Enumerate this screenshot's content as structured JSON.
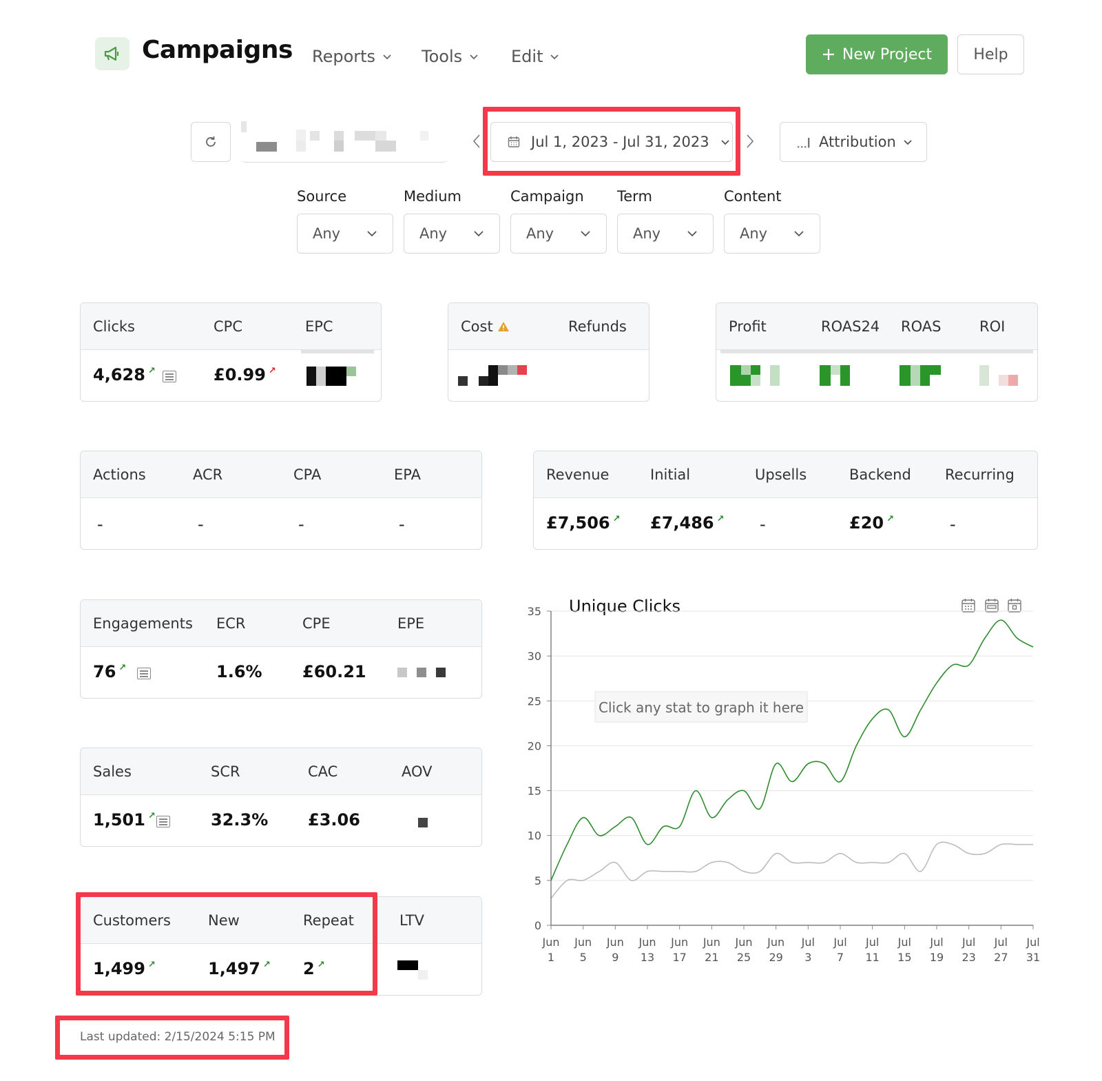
{
  "header": {
    "app_title": "Campaigns",
    "nav": [
      "Reports",
      "Tools",
      "Edit"
    ],
    "new_project_label": "New Project",
    "help_label": "Help"
  },
  "toolbar": {
    "date_range": "Jul 1, 2023 - Jul 31, 2023",
    "attribution_label": "Attribution"
  },
  "filters": [
    {
      "label": "Source",
      "value": "Any"
    },
    {
      "label": "Medium",
      "value": "Any"
    },
    {
      "label": "Campaign",
      "value": "Any"
    },
    {
      "label": "Term",
      "value": "Any"
    },
    {
      "label": "Content",
      "value": "Any"
    }
  ],
  "cards": {
    "traffic": {
      "headers": [
        "Clicks",
        "CPC",
        "EPC"
      ],
      "values": [
        "4,628",
        "£0.99"
      ]
    },
    "cost": {
      "headers": [
        "Cost",
        "Refunds"
      ]
    },
    "profit": {
      "headers": [
        "Profit",
        "ROAS24",
        "ROAS",
        "ROI"
      ]
    },
    "actions": {
      "headers": [
        "Actions",
        "ACR",
        "CPA",
        "EPA"
      ],
      "values": [
        "-",
        "-",
        "-",
        "-"
      ]
    },
    "revenue": {
      "headers": [
        "Revenue",
        "Initial",
        "Upsells",
        "Backend",
        "Recurring"
      ],
      "values": [
        "£7,506",
        "£7,486",
        "-",
        "£20",
        "-"
      ]
    },
    "engagements": {
      "headers": [
        "Engagements",
        "ECR",
        "CPE",
        "EPE"
      ],
      "values": [
        "76",
        "1.6%",
        "£60.21"
      ]
    },
    "sales": {
      "headers": [
        "Sales",
        "SCR",
        "CAC",
        "AOV"
      ],
      "values": [
        "1,501",
        "32.3%",
        "£3.06"
      ]
    },
    "customers": {
      "headers": [
        "Customers",
        "New",
        "Repeat",
        "LTV"
      ],
      "values": [
        "1,499",
        "1,497",
        "2"
      ]
    }
  },
  "chart_data": {
    "type": "line",
    "title": "Unique Clicks",
    "placeholder_text": "Click any stat to graph it here",
    "x": [
      "Jun 1",
      "Jun 3",
      "Jun 5",
      "Jun 7",
      "Jun 9",
      "Jun 11",
      "Jun 13",
      "Jun 15",
      "Jun 17",
      "Jun 19",
      "Jun 21",
      "Jun 23",
      "Jun 25",
      "Jun 27",
      "Jun 29",
      "Jul 1",
      "Jul 3",
      "Jul 5",
      "Jul 7",
      "Jul 9",
      "Jul 11",
      "Jul 13",
      "Jul 15",
      "Jul 17",
      "Jul 19",
      "Jul 21",
      "Jul 23",
      "Jul 25",
      "Jul 27",
      "Jul 29",
      "Jul 31"
    ],
    "x_tick_labels": [
      "Jun 1",
      "Jun 5",
      "Jun 9",
      "Jun 13",
      "Jun 17",
      "Jun 21",
      "Jun 25",
      "Jun 29",
      "Jul 3",
      "Jul 7",
      "Jul 11",
      "Jul 15",
      "Jul 19",
      "Jul 23",
      "Jul 27",
      "Jul 31"
    ],
    "series": [
      {
        "color": "#2e8b2e",
        "values": [
          5,
          9,
          12,
          10,
          11,
          12,
          9,
          11,
          11,
          15,
          12,
          14,
          15,
          13,
          18,
          16,
          18,
          18,
          16,
          20,
          23,
          24,
          21,
          24,
          27,
          29,
          29,
          32,
          34,
          32,
          31
        ]
      },
      {
        "color": "#bdbdbd",
        "values": [
          3,
          5,
          5,
          6,
          7,
          5,
          6,
          6,
          6,
          6,
          7,
          7,
          6,
          6,
          8,
          7,
          7,
          7,
          8,
          7,
          7,
          7,
          8,
          6,
          9,
          9,
          8,
          8,
          9,
          9,
          9
        ]
      }
    ],
    "ylim": [
      0,
      35
    ],
    "y_ticks": [
      0,
      5,
      10,
      15,
      20,
      25,
      30,
      35
    ],
    "grid": true
  },
  "footer": {
    "last_updated": "Last updated: 2/15/2024 5:15 PM"
  }
}
